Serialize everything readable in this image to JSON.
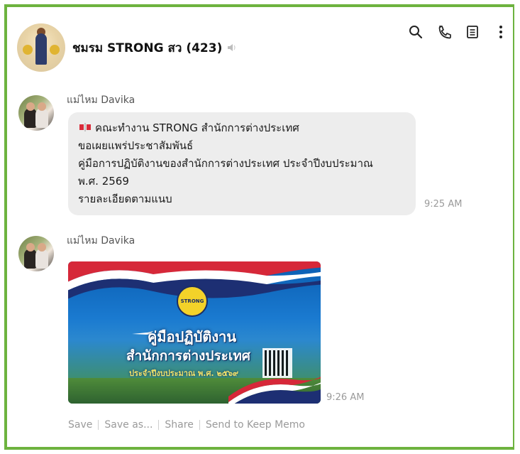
{
  "header": {
    "group_name": "ชมรม STRONG สว (423)",
    "icons": [
      "search-icon",
      "phone-icon",
      "notes-icon",
      "more-icon",
      "mute-icon"
    ]
  },
  "messages": [
    {
      "sender": "แม่ไหม Davika",
      "lines": [
        "คณะทำงาน STRONG สำนักการต่างประเทศ",
        "ขอเผยแพร่ประชาสัมพันธ์",
        "คู่มือการปฏิบัติงานของสำนักการต่างประเทศ ประจำปีงบประมาณ",
        "พ.ศ. 2569",
        "รายละเอียดตามแนบ"
      ],
      "time": "9:25 AM"
    },
    {
      "sender": "แม่ไหม Davika",
      "image": {
        "title_line1": "คู่มือปฏิบัติงาน",
        "title_line2": "สำนักการต่างประเทศ",
        "subtitle": "ประจำปีงบประมาณ พ.ศ. ๒๕๖๙",
        "logo_text": "STRONG"
      },
      "time": "9:26 AM",
      "actions": [
        "Save",
        "Save as...",
        "Share",
        "Send to Keep Memo"
      ]
    }
  ],
  "colors": {
    "frame_border": "#6db33f",
    "bubble_bg": "#ededed",
    "muted_text": "#9a9a9a"
  }
}
